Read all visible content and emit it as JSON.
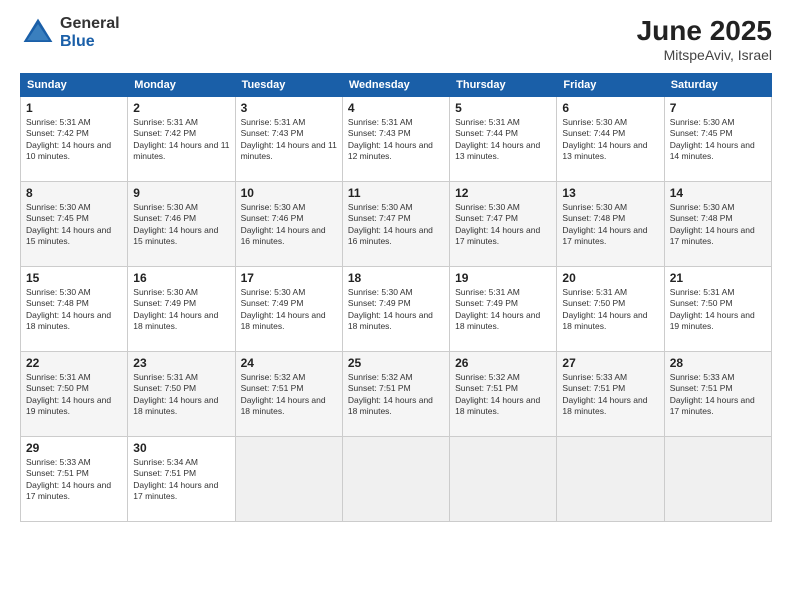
{
  "logo": {
    "general": "General",
    "blue": "Blue"
  },
  "title": "June 2025",
  "location": "MitspeAviv, Israel",
  "days_header": [
    "Sunday",
    "Monday",
    "Tuesday",
    "Wednesday",
    "Thursday",
    "Friday",
    "Saturday"
  ],
  "weeks": [
    [
      {
        "day": "1",
        "sunrise": "Sunrise: 5:31 AM",
        "sunset": "Sunset: 7:42 PM",
        "daylight": "Daylight: 14 hours and 10 minutes."
      },
      {
        "day": "2",
        "sunrise": "Sunrise: 5:31 AM",
        "sunset": "Sunset: 7:42 PM",
        "daylight": "Daylight: 14 hours and 11 minutes."
      },
      {
        "day": "3",
        "sunrise": "Sunrise: 5:31 AM",
        "sunset": "Sunset: 7:43 PM",
        "daylight": "Daylight: 14 hours and 11 minutes."
      },
      {
        "day": "4",
        "sunrise": "Sunrise: 5:31 AM",
        "sunset": "Sunset: 7:43 PM",
        "daylight": "Daylight: 14 hours and 12 minutes."
      },
      {
        "day": "5",
        "sunrise": "Sunrise: 5:31 AM",
        "sunset": "Sunset: 7:44 PM",
        "daylight": "Daylight: 14 hours and 13 minutes."
      },
      {
        "day": "6",
        "sunrise": "Sunrise: 5:30 AM",
        "sunset": "Sunset: 7:44 PM",
        "daylight": "Daylight: 14 hours and 13 minutes."
      },
      {
        "day": "7",
        "sunrise": "Sunrise: 5:30 AM",
        "sunset": "Sunset: 7:45 PM",
        "daylight": "Daylight: 14 hours and 14 minutes."
      }
    ],
    [
      {
        "day": "8",
        "sunrise": "Sunrise: 5:30 AM",
        "sunset": "Sunset: 7:45 PM",
        "daylight": "Daylight: 14 hours and 15 minutes."
      },
      {
        "day": "9",
        "sunrise": "Sunrise: 5:30 AM",
        "sunset": "Sunset: 7:46 PM",
        "daylight": "Daylight: 14 hours and 15 minutes."
      },
      {
        "day": "10",
        "sunrise": "Sunrise: 5:30 AM",
        "sunset": "Sunset: 7:46 PM",
        "daylight": "Daylight: 14 hours and 16 minutes."
      },
      {
        "day": "11",
        "sunrise": "Sunrise: 5:30 AM",
        "sunset": "Sunset: 7:47 PM",
        "daylight": "Daylight: 14 hours and 16 minutes."
      },
      {
        "day": "12",
        "sunrise": "Sunrise: 5:30 AM",
        "sunset": "Sunset: 7:47 PM",
        "daylight": "Daylight: 14 hours and 17 minutes."
      },
      {
        "day": "13",
        "sunrise": "Sunrise: 5:30 AM",
        "sunset": "Sunset: 7:48 PM",
        "daylight": "Daylight: 14 hours and 17 minutes."
      },
      {
        "day": "14",
        "sunrise": "Sunrise: 5:30 AM",
        "sunset": "Sunset: 7:48 PM",
        "daylight": "Daylight: 14 hours and 17 minutes."
      }
    ],
    [
      {
        "day": "15",
        "sunrise": "Sunrise: 5:30 AM",
        "sunset": "Sunset: 7:48 PM",
        "daylight": "Daylight: 14 hours and 18 minutes."
      },
      {
        "day": "16",
        "sunrise": "Sunrise: 5:30 AM",
        "sunset": "Sunset: 7:49 PM",
        "daylight": "Daylight: 14 hours and 18 minutes."
      },
      {
        "day": "17",
        "sunrise": "Sunrise: 5:30 AM",
        "sunset": "Sunset: 7:49 PM",
        "daylight": "Daylight: 14 hours and 18 minutes."
      },
      {
        "day": "18",
        "sunrise": "Sunrise: 5:30 AM",
        "sunset": "Sunset: 7:49 PM",
        "daylight": "Daylight: 14 hours and 18 minutes."
      },
      {
        "day": "19",
        "sunrise": "Sunrise: 5:31 AM",
        "sunset": "Sunset: 7:49 PM",
        "daylight": "Daylight: 14 hours and 18 minutes."
      },
      {
        "day": "20",
        "sunrise": "Sunrise: 5:31 AM",
        "sunset": "Sunset: 7:50 PM",
        "daylight": "Daylight: 14 hours and 18 minutes."
      },
      {
        "day": "21",
        "sunrise": "Sunrise: 5:31 AM",
        "sunset": "Sunset: 7:50 PM",
        "daylight": "Daylight: 14 hours and 19 minutes."
      }
    ],
    [
      {
        "day": "22",
        "sunrise": "Sunrise: 5:31 AM",
        "sunset": "Sunset: 7:50 PM",
        "daylight": "Daylight: 14 hours and 19 minutes."
      },
      {
        "day": "23",
        "sunrise": "Sunrise: 5:31 AM",
        "sunset": "Sunset: 7:50 PM",
        "daylight": "Daylight: 14 hours and 18 minutes."
      },
      {
        "day": "24",
        "sunrise": "Sunrise: 5:32 AM",
        "sunset": "Sunset: 7:51 PM",
        "daylight": "Daylight: 14 hours and 18 minutes."
      },
      {
        "day": "25",
        "sunrise": "Sunrise: 5:32 AM",
        "sunset": "Sunset: 7:51 PM",
        "daylight": "Daylight: 14 hours and 18 minutes."
      },
      {
        "day": "26",
        "sunrise": "Sunrise: 5:32 AM",
        "sunset": "Sunset: 7:51 PM",
        "daylight": "Daylight: 14 hours and 18 minutes."
      },
      {
        "day": "27",
        "sunrise": "Sunrise: 5:33 AM",
        "sunset": "Sunset: 7:51 PM",
        "daylight": "Daylight: 14 hours and 18 minutes."
      },
      {
        "day": "28",
        "sunrise": "Sunrise: 5:33 AM",
        "sunset": "Sunset: 7:51 PM",
        "daylight": "Daylight: 14 hours and 17 minutes."
      }
    ],
    [
      {
        "day": "29",
        "sunrise": "Sunrise: 5:33 AM",
        "sunset": "Sunset: 7:51 PM",
        "daylight": "Daylight: 14 hours and 17 minutes."
      },
      {
        "day": "30",
        "sunrise": "Sunrise: 5:34 AM",
        "sunset": "Sunset: 7:51 PM",
        "daylight": "Daylight: 14 hours and 17 minutes."
      },
      null,
      null,
      null,
      null,
      null
    ]
  ]
}
